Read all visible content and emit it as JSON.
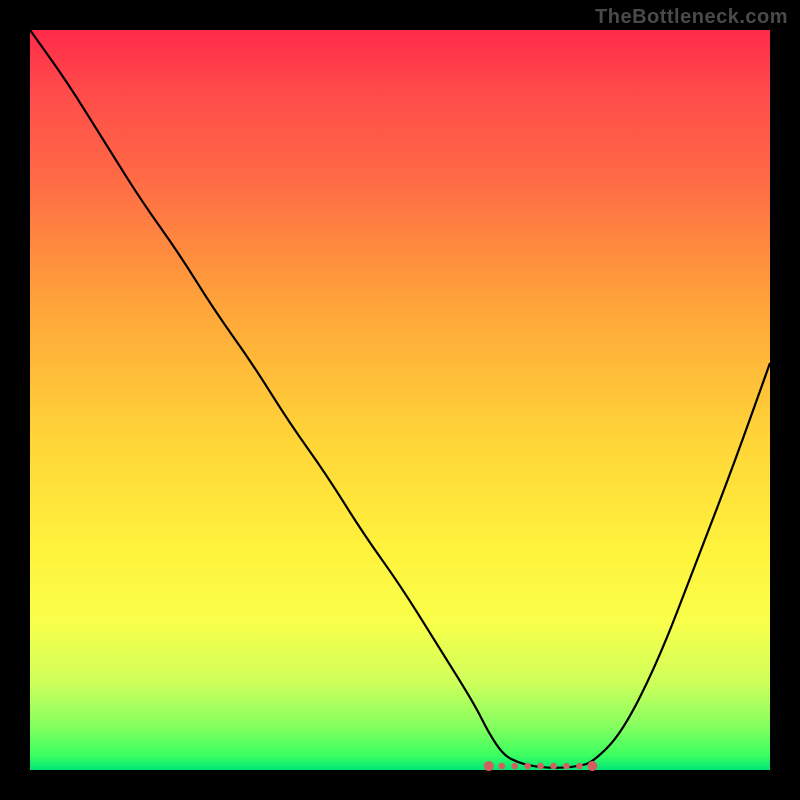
{
  "watermark": "TheBottleneck.com",
  "colors": {
    "gradient_top": "#ff2a4a",
    "gradient_mid": "#fff23c",
    "gradient_bottom": "#00e676",
    "curve": "#000000",
    "marker": "#d16060",
    "frame": "#000000"
  },
  "chart_data": {
    "type": "line",
    "title": "",
    "xlabel": "",
    "ylabel": "",
    "xlim": [
      0,
      100
    ],
    "ylim": [
      0,
      100
    ],
    "x": [
      0,
      5,
      10,
      15,
      20,
      25,
      30,
      35,
      40,
      45,
      50,
      55,
      60,
      62,
      64,
      66,
      68,
      70,
      72,
      74,
      76,
      80,
      85,
      90,
      95,
      100
    ],
    "values": [
      100,
      93,
      85,
      77,
      70,
      62,
      55,
      47,
      40,
      32,
      25,
      17,
      9,
      5,
      2,
      1,
      0.5,
      0.3,
      0.3,
      0.5,
      1,
      5,
      15,
      28,
      41,
      55
    ],
    "marker_region": {
      "x_start": 62,
      "x_end": 76,
      "y": 0.4
    },
    "notes": "Units are percent of axis; no tick labels visible. Curve descends from top-left to a flat minimum near x≈62–76, then rises to mid-right. Marker dots sit along the flat minimum."
  }
}
